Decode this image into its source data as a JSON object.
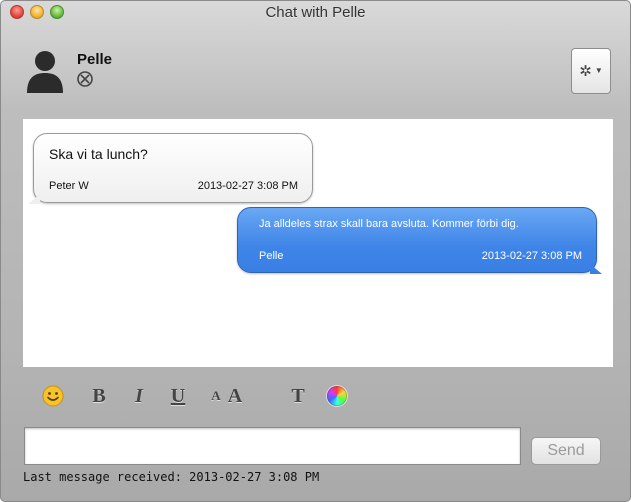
{
  "window": {
    "title": "Chat with Pelle"
  },
  "contact": {
    "name": "Pelle",
    "status_icon": "offline-icon"
  },
  "header": {
    "settings_icon": "gear-icon"
  },
  "messages": [
    {
      "direction": "incoming",
      "text": "Ska vi ta lunch?",
      "sender": "Peter W",
      "time": "2013-02-27 3:08 PM"
    },
    {
      "direction": "outgoing",
      "text": "Ja alldeles strax skall bara avsluta. Kommer förbi dig.",
      "sender": "Pelle",
      "time": "2013-02-27 3:08 PM"
    }
  ],
  "toolbar": {
    "smiley_icon": "smiley-icon",
    "bold": "B",
    "italic": "I",
    "underline": "U",
    "smaller_text": "A",
    "larger_text": "A",
    "font": "T",
    "color_icon": "color-wheel-icon"
  },
  "input": {
    "value": "",
    "placeholder": ""
  },
  "send_label": "Send",
  "status_text": "Last message received: 2013-02-27 3:08 PM",
  "colors": {
    "outgoing_bubble": "#3f85e8",
    "incoming_bubble": "#efefef",
    "close": "#e0443a",
    "minimize": "#f0b132",
    "zoom": "#63b83c"
  }
}
